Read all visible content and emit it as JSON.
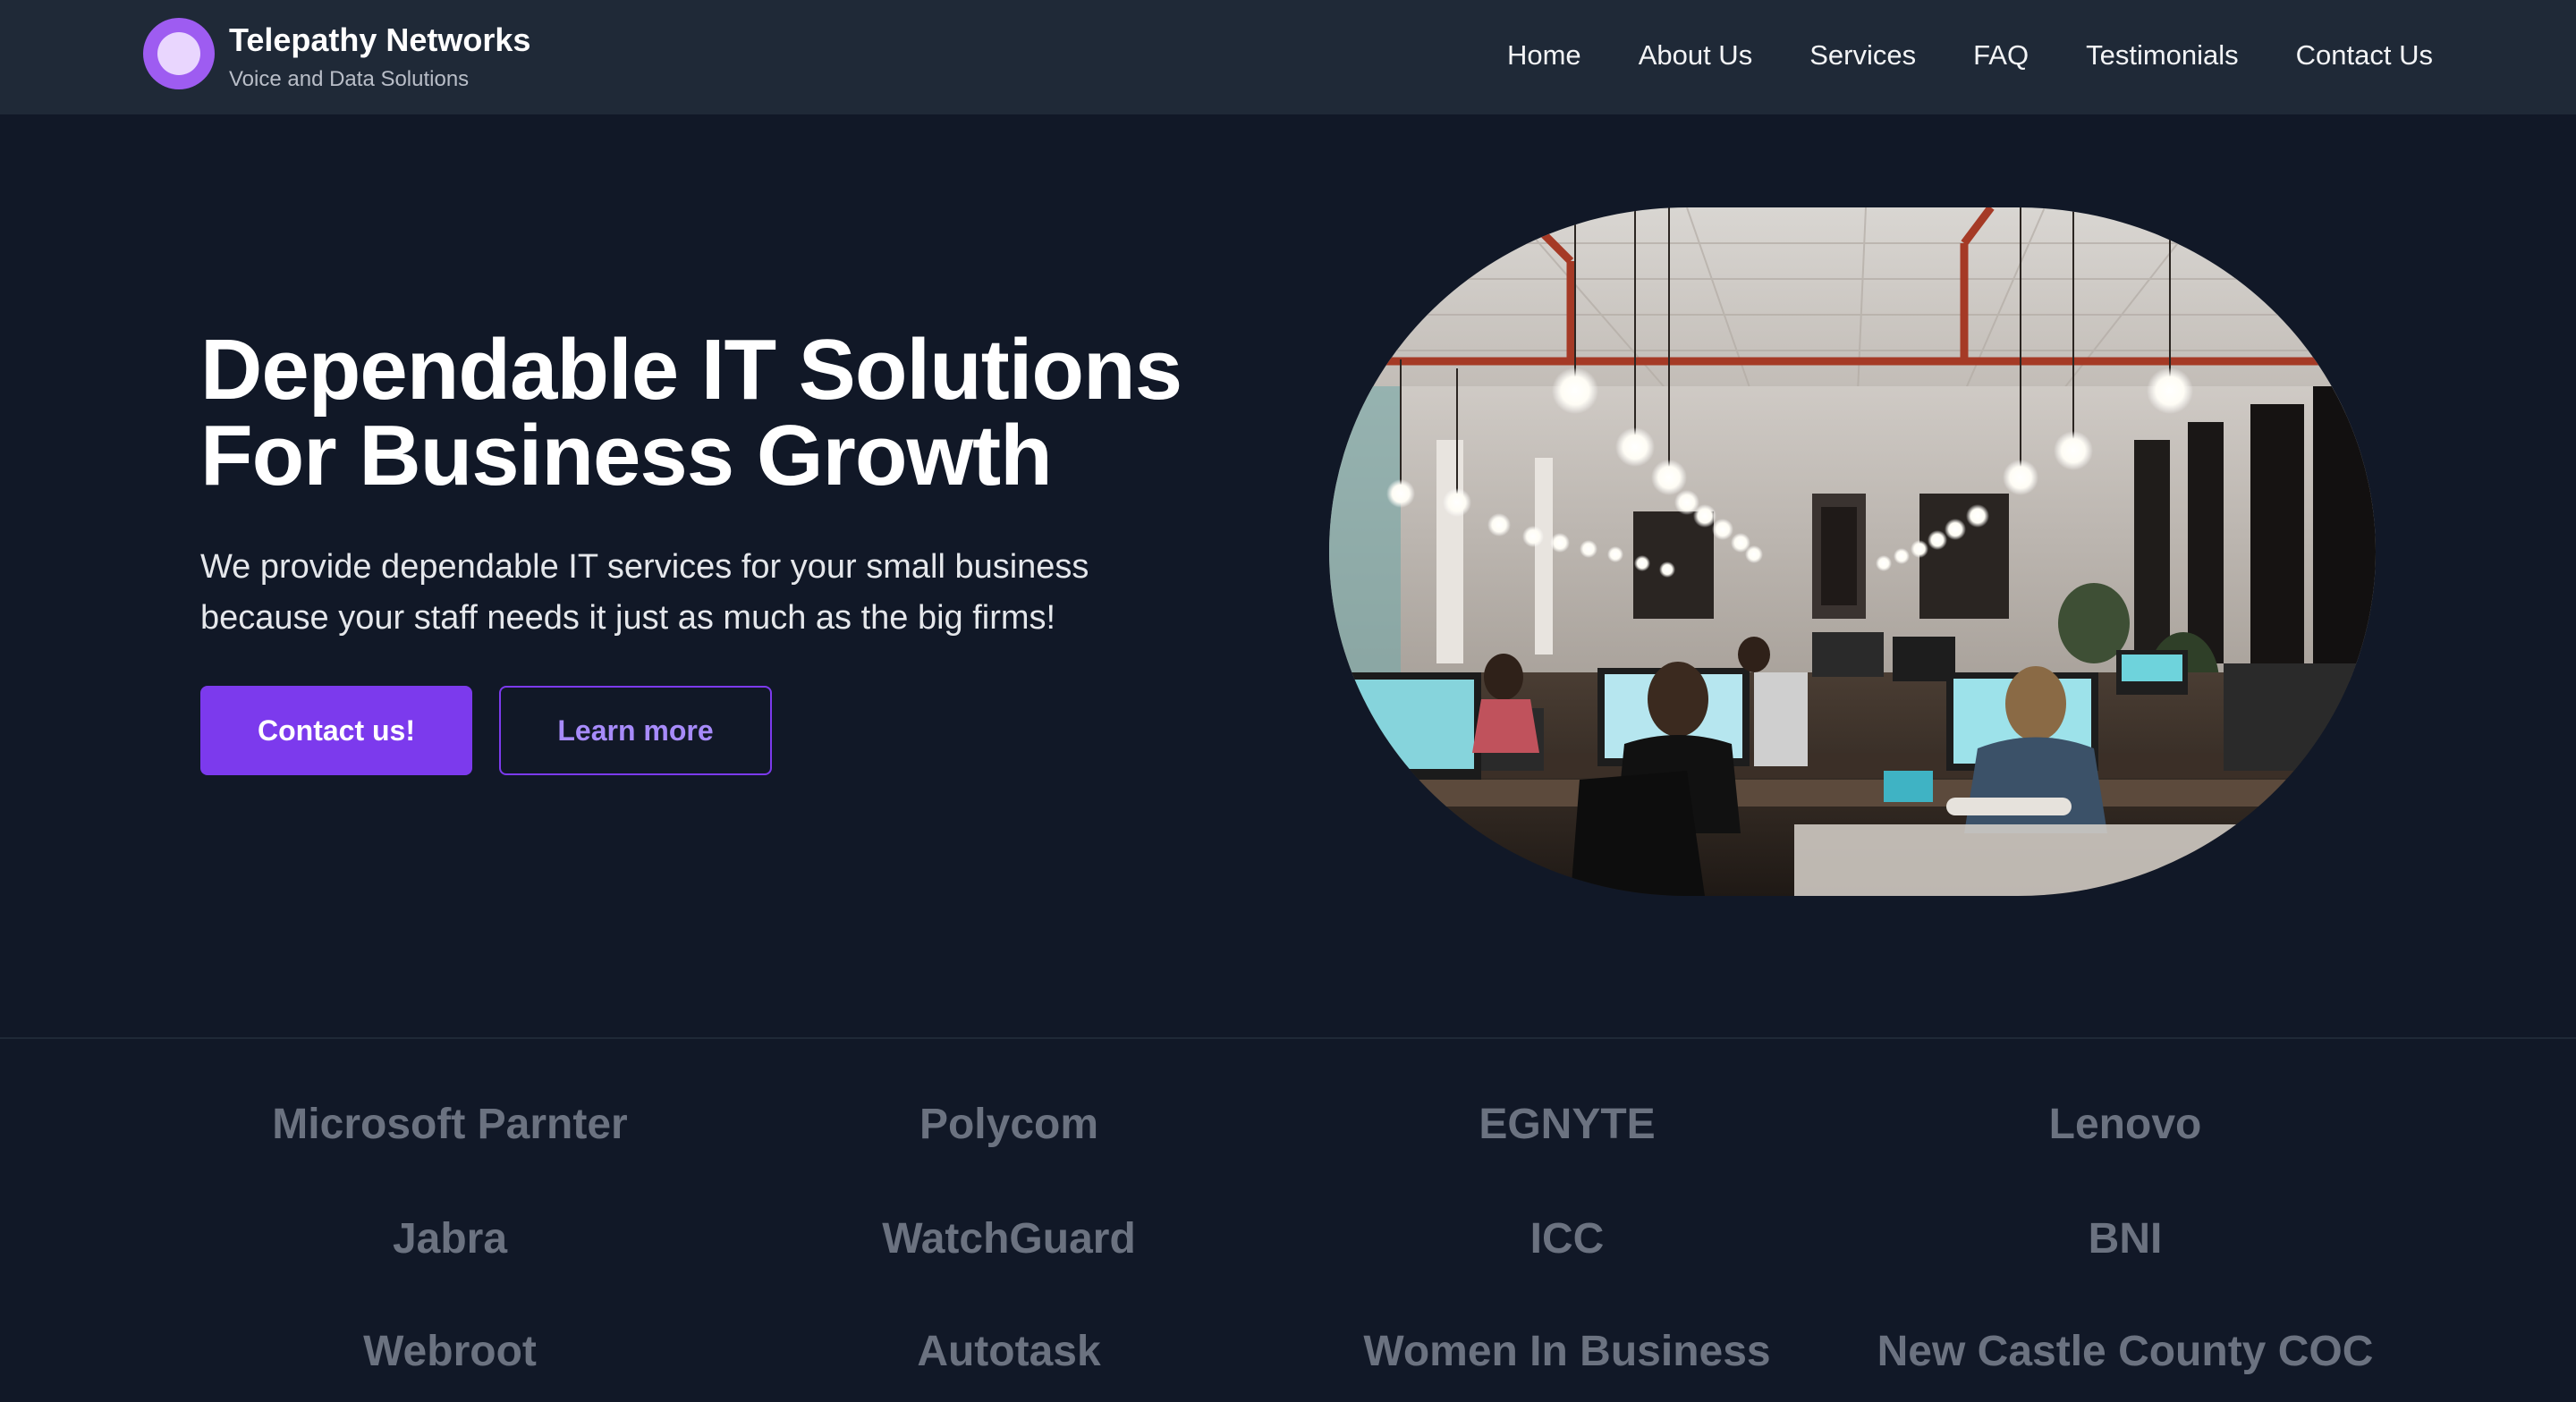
{
  "brand": {
    "name": "Telepathy Networks",
    "tagline": "Voice and Data Solutions"
  },
  "nav": {
    "items": [
      "Home",
      "About Us",
      "Services",
      "FAQ",
      "Testimonials",
      "Contact Us"
    ]
  },
  "hero": {
    "title_line1": "Dependable IT Solutions",
    "title_line2": "For Business Growth",
    "subtitle_line1": "We provide dependable IT services for your small business",
    "subtitle_line2": "because your staff needs it just as much as the big firms!",
    "primary_button": "Contact us!",
    "secondary_button": "Learn more",
    "image_alt": "Open office with people working at computers under hanging light bulbs"
  },
  "partners": {
    "items": [
      "Microsoft Parnter",
      "Polycom",
      "EGNYTE",
      "Lenovo",
      "Jabra",
      "WatchGuard",
      "ICC",
      "BNI",
      "Webroot",
      "Autotask",
      "Women In Business",
      "New Castle County COC"
    ]
  },
  "colors": {
    "background": "#111827",
    "navbar": "#1f2937",
    "accent": "#7c3aed",
    "accent_light": "#a78bfa",
    "partner_text": "#6b7280"
  }
}
